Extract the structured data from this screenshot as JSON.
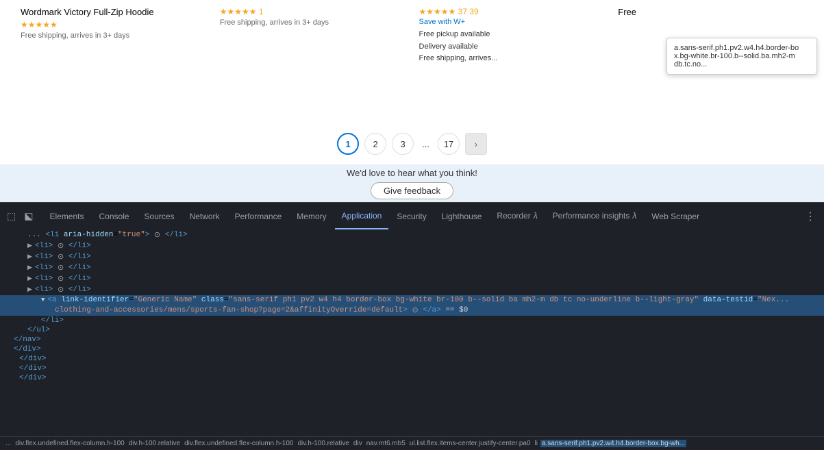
{
  "browser": {
    "products": [
      {
        "title": "Wordmark Victory Full-Zip Hoodie",
        "stars": "★★★★★",
        "star_count": "",
        "shipping": "Free shipping, arrives in 3+ days"
      },
      {
        "title": "",
        "stars": "★★★★★",
        "star_count": "1",
        "shipping": "Free shipping, arrives in 3+ days"
      },
      {
        "title": "",
        "stars": "★★★★★",
        "star_count": "37 39",
        "save_link": "Save with W+",
        "pickup": "Free pickup available\nDelivery available\nFree shipping, arrives..."
      },
      {
        "title": "Free",
        "stars": "",
        "star_count": ""
      }
    ],
    "tooltip": "a.sans-serif.ph1.pv2.w4.h4.border-bo\nx.bg-white.br-100.b--solid.ba.mh2-m\ndb.tc.no...",
    "pagination": {
      "pages": [
        "1",
        "2",
        "3",
        "...",
        "17"
      ],
      "active": "1",
      "next_label": "›"
    },
    "feedback": {
      "prompt": "We'd love to hear what you think!",
      "button_label": "Give feedback"
    }
  },
  "devtools": {
    "tabs": [
      {
        "label": "Elements",
        "active": false
      },
      {
        "label": "Console",
        "active": false
      },
      {
        "label": "Sources",
        "active": false
      },
      {
        "label": "Network",
        "active": false
      },
      {
        "label": "Performance",
        "active": false
      },
      {
        "label": "Memory",
        "active": false
      },
      {
        "label": "Application",
        "active": true
      },
      {
        "label": "Security",
        "active": false
      },
      {
        "label": "Lighthouse",
        "active": false
      },
      {
        "label": "Recorder 𝜆",
        "active": false
      },
      {
        "label": "Performance insights 𝜆",
        "active": false
      },
      {
        "label": "Web Scraper",
        "active": false
      }
    ],
    "dom_lines": [
      {
        "indent": 2,
        "content": "<li aria-hidden=\"true\"> ⊙ </li>",
        "highlighted": false
      },
      {
        "indent": 2,
        "content": "▶ <li> ⊙ </li>",
        "highlighted": false
      },
      {
        "indent": 2,
        "content": "▶ <li> ⊙ </li>",
        "highlighted": false
      },
      {
        "indent": 2,
        "content": "▶ <li> ⊙ </li>",
        "highlighted": false
      },
      {
        "indent": 2,
        "content": "▶ <li> ⊙ </li>",
        "highlighted": false
      },
      {
        "indent": 2,
        "content": "▶ <li> ⊙ </li>",
        "highlighted": false
      },
      {
        "indent": 3,
        "content": "▼ <a link-identifier=\"Generic Name\" class=\"sans-serif ph1 pv2 w4 h4 border-box bg-white br-100 b--solid ba mh2-m db tc no-underline b--light-gray\" data-testid=\"Nex...",
        "highlighted": true
      },
      {
        "indent": 4,
        "content": "clothing-and-accessories/mens/sports-fan-shop?page=2&affinityOverride=default\"> ⊙ </a> == $0",
        "highlighted": true
      },
      {
        "indent": 3,
        "content": "</li>",
        "highlighted": false
      },
      {
        "indent": 2,
        "content": "</ul>",
        "highlighted": false
      },
      {
        "indent": 1,
        "content": "</nav>",
        "highlighted": false
      },
      {
        "indent": 1,
        "content": "</div>",
        "highlighted": false
      },
      {
        "indent": 0,
        "content": "</div>",
        "highlighted": false
      },
      {
        "indent": 0,
        "content": "</div>",
        "highlighted": false
      },
      {
        "indent": 0,
        "content": "</div>",
        "highlighted": false
      }
    ],
    "breadcrumb": [
      "div.flex.undefined.flex-column.h-100",
      "div.h-100.relative",
      "div.flex.undefined.flex-column.h-100",
      "div.h-100.relative",
      "div",
      "nav.mt6.mb5",
      "ul.list.flex.items-center.justify-center.pa0",
      "li",
      "a.sans-serif.ph1.pv2.w4.h4.border-box.bg-wh..."
    ],
    "dots": "..."
  }
}
